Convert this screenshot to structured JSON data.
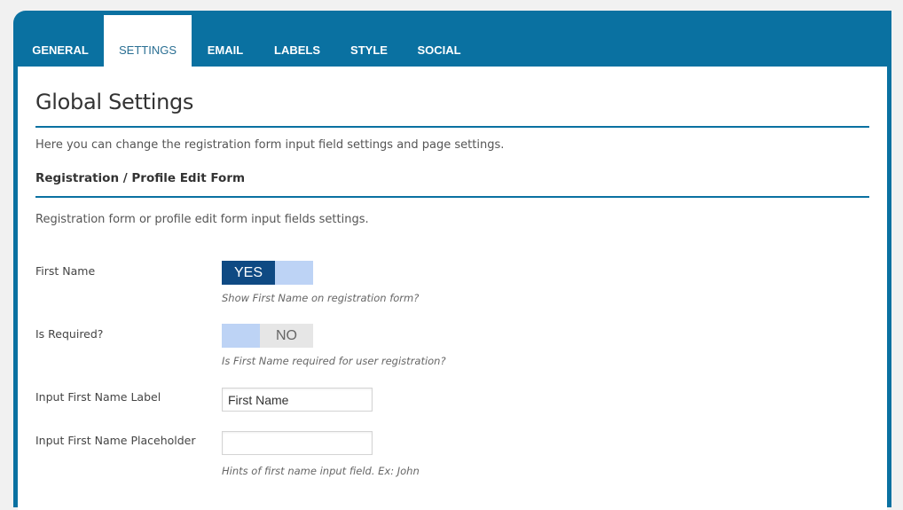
{
  "tabs": [
    {
      "label": "GENERAL",
      "active": false
    },
    {
      "label": "SETTINGS",
      "active": true
    },
    {
      "label": "EMAIL",
      "active": false
    },
    {
      "label": "LABELS",
      "active": false
    },
    {
      "label": "STYLE",
      "active": false
    },
    {
      "label": "SOCIAL",
      "active": false
    }
  ],
  "page": {
    "title": "Global Settings",
    "description": "Here you can change the registration form input field settings and page settings."
  },
  "section": {
    "title": "Registration / Profile Edit Form",
    "description": "Registration form or profile edit form input fields settings."
  },
  "fields": {
    "first_name": {
      "label": "First Name",
      "toggle_label": "YES",
      "hint": "Show First Name on registration form?"
    },
    "is_required": {
      "label": "Is Required?",
      "toggle_label": "NO",
      "hint": "Is First Name required for user registration?"
    },
    "input_label": {
      "label": "Input First Name Label",
      "value": "First Name"
    },
    "input_placeholder": {
      "label": "Input First Name Placeholder",
      "value": "",
      "hint": "Hints of first name input field. Ex: John"
    }
  },
  "colors": {
    "header_blue": "#0a71a1",
    "toggle_on": "#0f4a83",
    "toggle_track": "#bdd3f5"
  }
}
